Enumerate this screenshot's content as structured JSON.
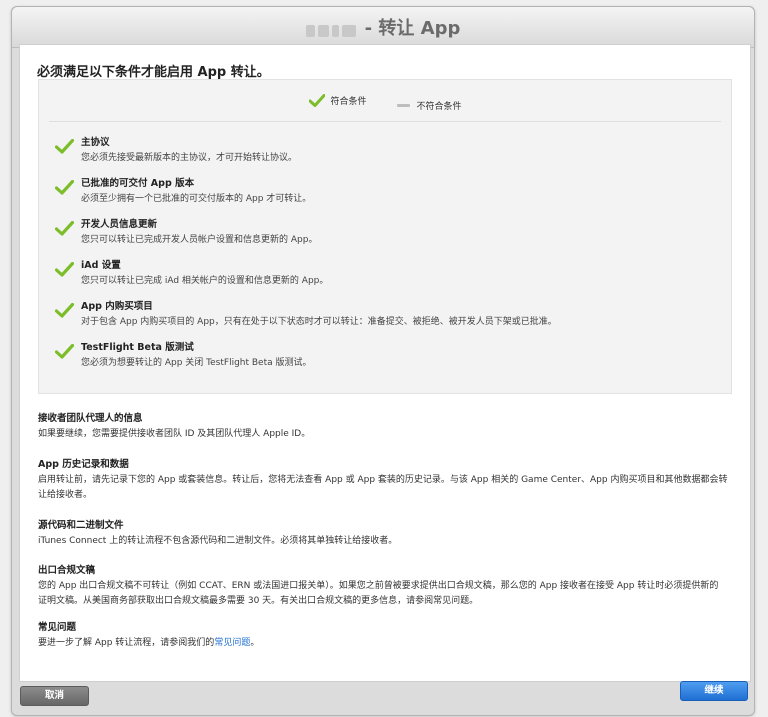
{
  "window": {
    "title": "- 转让 App",
    "title_prefix_redacted": true
  },
  "main": {
    "heading": "必须满足以下条件才能启用 App 转让。",
    "legend": {
      "met": "符合条件",
      "not_met": "不符合条件"
    },
    "requirements": [
      {
        "title": "主协议",
        "desc": "您必须先接受最新版本的主协议，才可开始转让协议。",
        "status": "met"
      },
      {
        "title": "已批准的可交付 App 版本",
        "desc": "必须至少拥有一个已批准的可交付版本的 App 才可转让。",
        "status": "met"
      },
      {
        "title": "开发人员信息更新",
        "desc": "您只可以转让已完成开发人员帐户设置和信息更新的 App。",
        "status": "met"
      },
      {
        "title": "iAd 设置",
        "desc": "您只可以转让已完成 iAd 相关帐户的设置和信息更新的 App。",
        "status": "met"
      },
      {
        "title": "App 内购买项目",
        "desc": "对于包含 App 内购买项目的 App，只有在处于以下状态时才可以转让：准备提交、被拒绝、被开发人员下架或已批准。",
        "status": "met"
      },
      {
        "title": "TestFlight Beta 版测试",
        "desc": "您必须为想要转让的 App 关闭 TestFlight Beta 版测试。",
        "status": "met"
      }
    ],
    "sections": [
      {
        "title": "接收者团队代理人的信息",
        "body": "如果要继续，您需要提供接收者团队 ID 及其团队代理人 Apple ID。"
      },
      {
        "title": "App 历史记录和数据",
        "body_lines": [
          "启用转让前，请先记录下您的 App 或套装信息。转让后，您将无法查看 App 或 App 套装的历史记录。与该 App 相关的 Game Center、App 内购买项目和其他数据都会转",
          "让给接收者。"
        ]
      },
      {
        "title": "源代码和二进制文件",
        "body": "iTunes Connect 上的转让流程不包含源代码和二进制文件。必须将其单独转让给接收者。"
      },
      {
        "title": "出口合规文稿",
        "body_lines": [
          "您的 App 出口合规文稿不可转让（例如 CCAT、ERN 或法国进口报关单）。如果您之前曾被要求提供出口合规文稿，那么您的 App 接收者在接受 App 转让时必须提供新的",
          "证明文稿。从美国商务部获取出口合规文稿最多需要 30 天。有关出口合规文稿的更多信息，请参阅常见问题。"
        ]
      },
      {
        "title": "常见问题",
        "body_prefix": "要进一步了解 App 转让流程，请参阅我们的",
        "link": "常见问题",
        "body_suffix": "。"
      }
    ]
  },
  "footer": {
    "cancel_label": "取消",
    "continue_label": "继续"
  },
  "colors": {
    "check_green": "#7cbd2a",
    "link_blue": "#1f6fd1",
    "primary_button": "#2a7fe0"
  }
}
